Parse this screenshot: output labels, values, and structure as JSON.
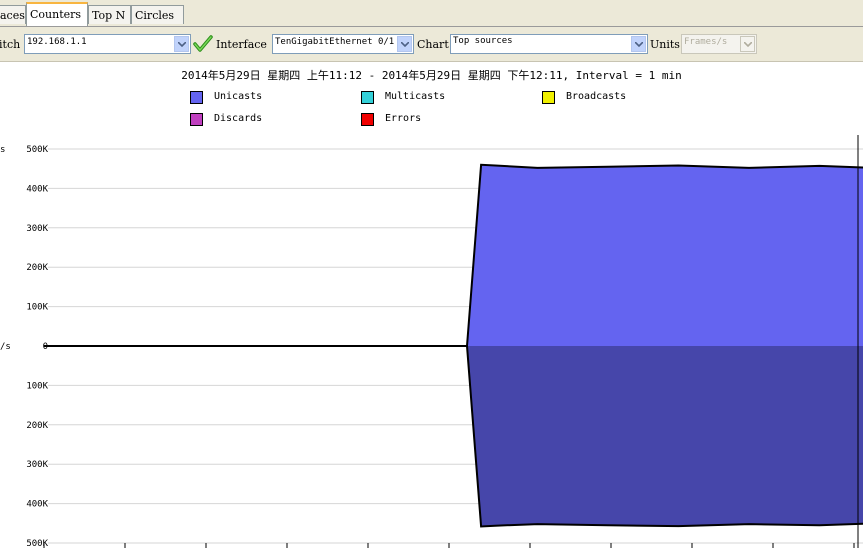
{
  "tabs": [
    {
      "label": "aces",
      "active": false
    },
    {
      "label": "Counters",
      "active": true
    },
    {
      "label": "Top N",
      "active": false
    },
    {
      "label": "Circles",
      "active": false
    }
  ],
  "toolbar": {
    "switch_label": "itch",
    "switch_value": "192.168.1.1",
    "interface_label": "Interface",
    "interface_value": "TenGigabitEthernet 0/1",
    "chart_label": "Chart",
    "chart_value": "Top sources",
    "units_label": "Units",
    "units_value": "Frames/s"
  },
  "header": {
    "range": "2014年5月29日 星期四 上午11:12 - 2014年5月29日 星期四 下午12:11, Interval = 1 min"
  },
  "legend": [
    {
      "label": "Unicasts",
      "color": "#6464f0"
    },
    {
      "label": "Multicasts",
      "color": "#33d0d8"
    },
    {
      "label": "Broadcasts",
      "color": "#f0f000"
    },
    {
      "label": "Discards",
      "color": "#c040c0"
    },
    {
      "label": "Errors",
      "color": "#f00000"
    }
  ],
  "axis": {
    "y_unit_top": "s",
    "y_unit_mid": "/s"
  },
  "chart_data": {
    "type": "area",
    "title": "",
    "xlabel": "",
    "ylabel": "",
    "ylim": [
      -500000,
      500000
    ],
    "y_ticks": [
      "500K",
      "400K",
      "300K",
      "200K",
      "100K",
      "0",
      "100K",
      "200K",
      "300K",
      "400K",
      "500K"
    ],
    "x_index": [
      0,
      5,
      10,
      15,
      20,
      25,
      30,
      31,
      32,
      35,
      40,
      45,
      50,
      55,
      59
    ],
    "series": [
      {
        "name": "Unicasts",
        "color": "#6464f0",
        "values": [
          0,
          0,
          0,
          0,
          0,
          0,
          0,
          460000,
          458000,
          452000,
          455000,
          458000,
          452000,
          457000,
          452000
        ]
      },
      {
        "name": "Unicasts",
        "color": "#4646aa",
        "values": [
          0,
          0,
          0,
          0,
          0,
          0,
          0,
          -458000,
          -456000,
          -452000,
          -455000,
          -457000,
          -452000,
          -455000,
          -450000
        ]
      }
    ]
  }
}
